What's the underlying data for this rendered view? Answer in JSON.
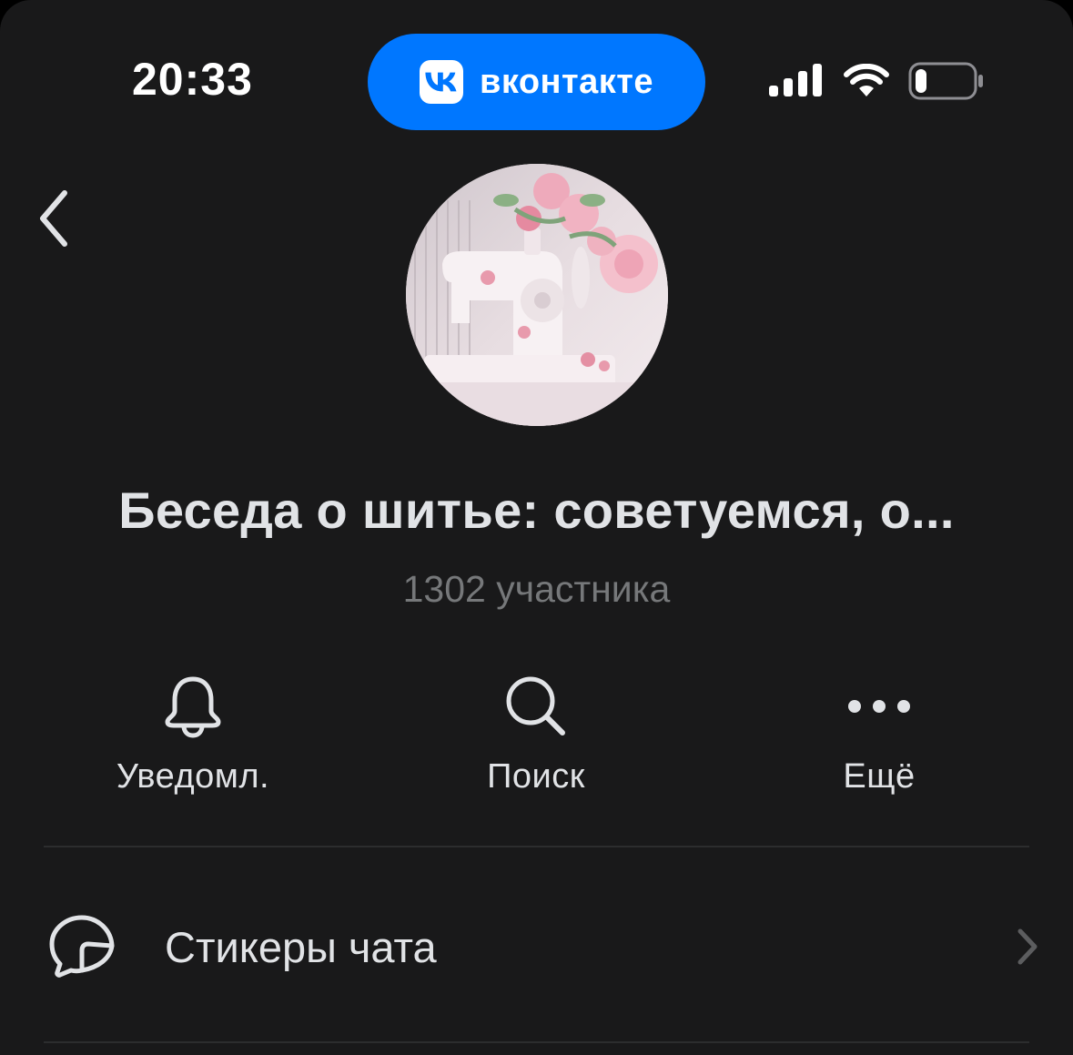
{
  "status_bar": {
    "time": "20:33",
    "island_app_label": "вконтакте",
    "island_icon": "vk-logo-icon",
    "accent_color": "#0077ff",
    "battery_level": 0.2
  },
  "header": {
    "back_icon": "chevron-left-icon",
    "avatar_description": "sewing-machine-with-roses"
  },
  "chat": {
    "title": "Беседа о шитье: советуемся, о...",
    "members": "1302 участника"
  },
  "actions": [
    {
      "label": "Уведомл.",
      "icon": "bell-icon"
    },
    {
      "label": "Поиск",
      "icon": "search-icon"
    },
    {
      "label": "Ещё",
      "icon": "more-horizontal-icon"
    }
  ],
  "list": {
    "stickers_label": "Стикеры чата",
    "stickers_icon": "sticker-icon"
  },
  "colors": {
    "background": "#19191a",
    "primary_text": "#e1e3e6",
    "secondary_text": "#76787a",
    "divider": "#2c2d2e"
  }
}
